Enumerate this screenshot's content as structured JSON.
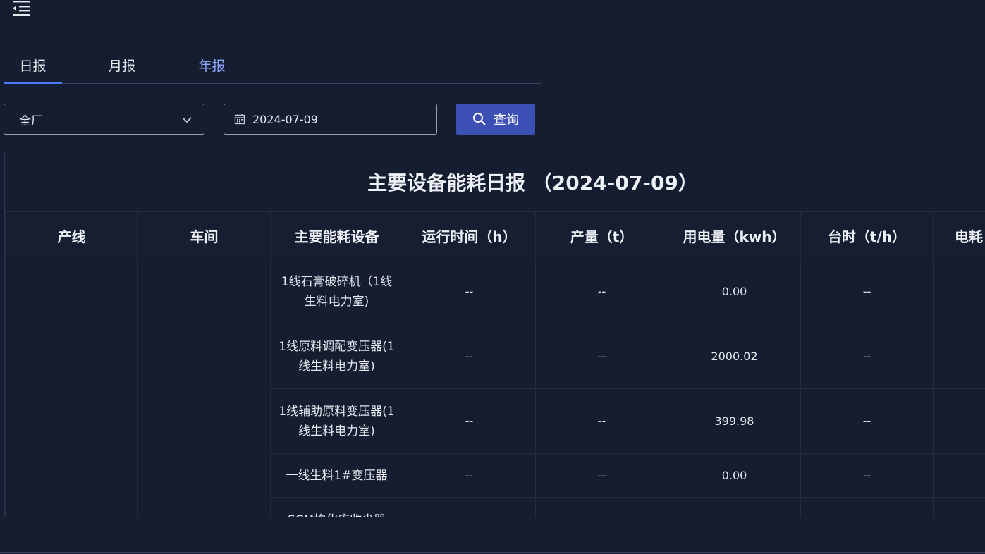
{
  "header": {
    "menu_icon": "menu-fold-icon"
  },
  "tabs": [
    {
      "label": "日报",
      "active": true
    },
    {
      "label": "月报",
      "active": false
    },
    {
      "label": "年报",
      "active": false
    }
  ],
  "filters": {
    "scope_value": "全厂",
    "date_value": "2024-07-09",
    "query_label": "查询"
  },
  "report": {
    "title": "主要设备能耗日报 （2024-07-09）",
    "columns": [
      "产线",
      "车间",
      "主要能耗设备",
      "运行时间（h）",
      "产量（t）",
      "用电量（kwh）",
      "台时（t/h）",
      "电耗"
    ],
    "rows": [
      {
        "line": "",
        "workshop": "",
        "device": "1线石膏破碎机（1线生料电力室)",
        "runtime": "--",
        "output": "--",
        "power": "0.00",
        "rate": "--",
        "consumption": ""
      },
      {
        "line": "",
        "workshop": "",
        "device": "1线原料调配变压器(1线生料电力室)",
        "runtime": "--",
        "output": "--",
        "power": "2000.02",
        "rate": "--",
        "consumption": ""
      },
      {
        "line": "",
        "workshop": "",
        "device": "1线辅助原料变压器(1线生料电力室)",
        "runtime": "--",
        "output": "--",
        "power": "399.98",
        "rate": "--",
        "consumption": ""
      },
      {
        "line": "",
        "workshop": "",
        "device": "一线生料1#变压器",
        "runtime": "--",
        "output": "--",
        "power": "0.00",
        "rate": "--",
        "consumption": ""
      },
      {
        "line": "",
        "workshop": "",
        "device": "SCM均化库收尘器",
        "runtime": "",
        "output": "",
        "power": "",
        "rate": "",
        "consumption": ""
      }
    ]
  }
}
